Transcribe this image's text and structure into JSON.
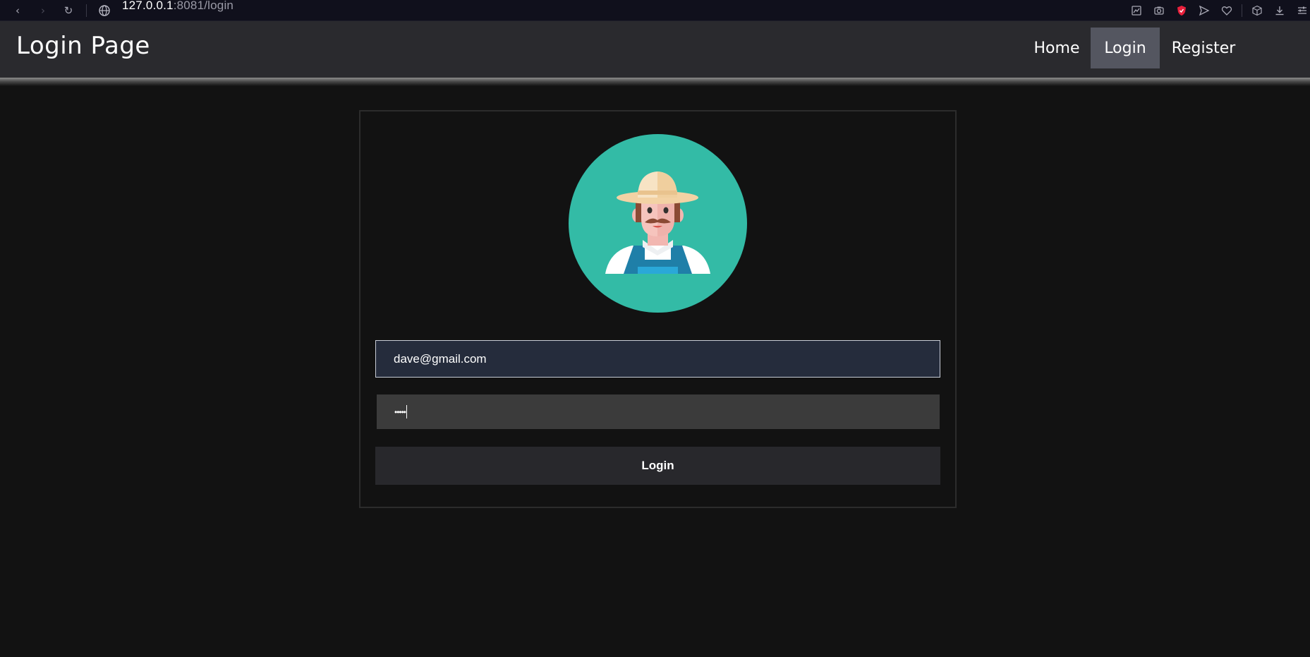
{
  "browser": {
    "url_host": "127.0.0.1",
    "url_rest": ":8081/login"
  },
  "navbar": {
    "title": "Login Page",
    "links": [
      {
        "label": "Home",
        "active": false
      },
      {
        "label": "Login",
        "active": true
      },
      {
        "label": "Register",
        "active": false
      }
    ]
  },
  "form": {
    "email_value": "dave@gmail.com",
    "password_mask": "•••••",
    "submit_label": "Login"
  },
  "avatar": {
    "icon": "farmer-avatar-icon",
    "background_color": "#33bba6"
  },
  "colors": {
    "page_bg": "#121212",
    "navbar_bg": "#2a2a2e",
    "active_nav_bg": "#545660",
    "email_field_bg": "#252c3c",
    "password_field_bg": "#3b3b3b",
    "button_bg": "#28282c"
  }
}
